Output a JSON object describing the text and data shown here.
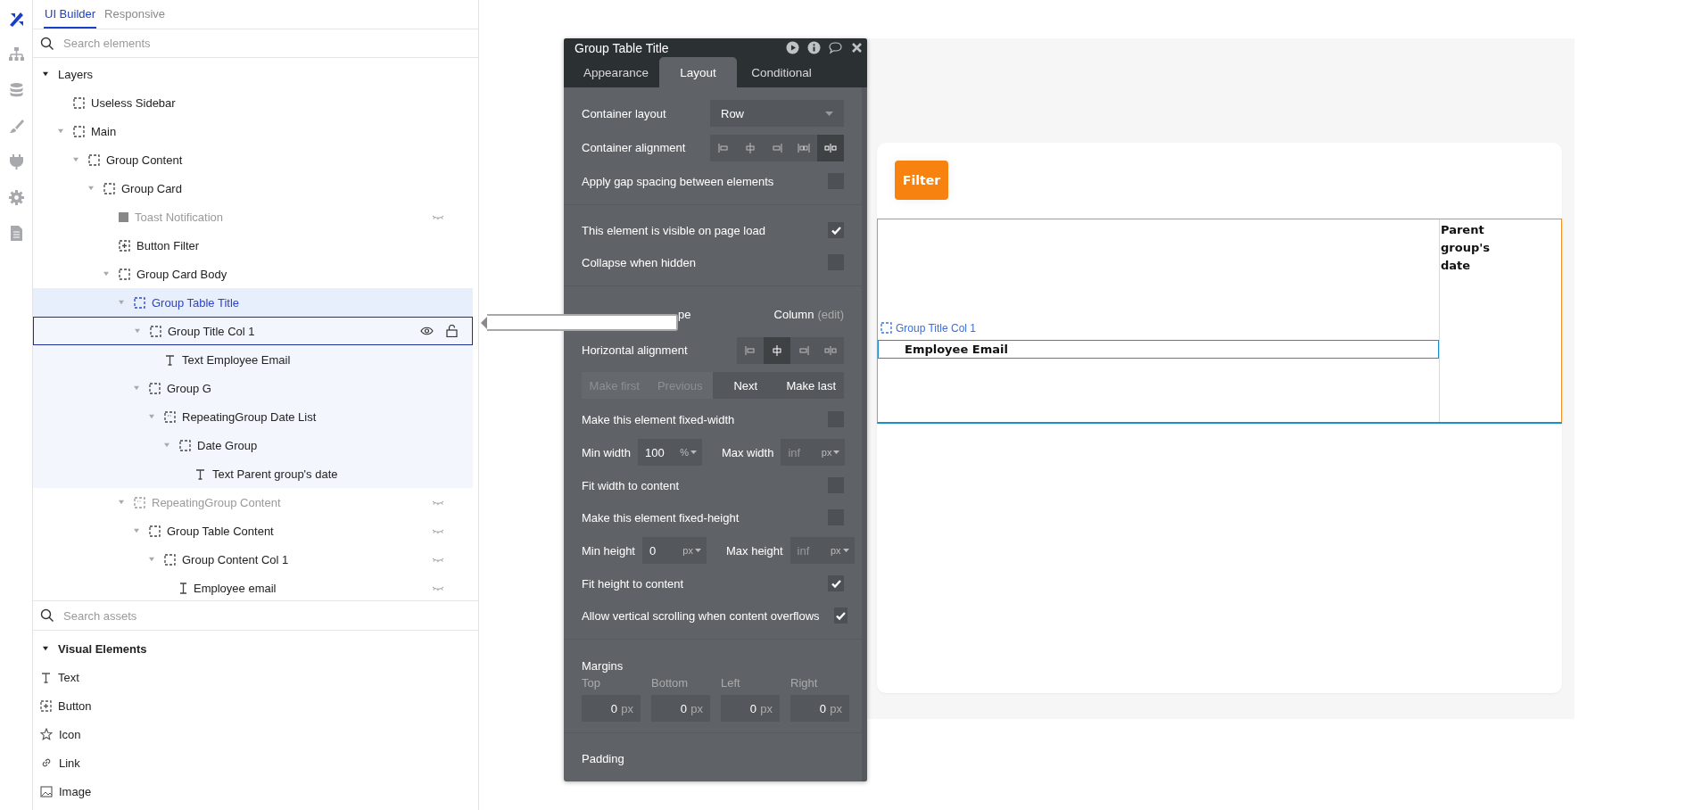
{
  "rail": {
    "items": [
      {
        "kind": "design",
        "selected": true
      },
      {
        "kind": "structure",
        "selected": false
      },
      {
        "kind": "data",
        "selected": false
      },
      {
        "kind": "styles",
        "selected": false
      },
      {
        "kind": "plugins",
        "selected": false
      },
      {
        "kind": "settings",
        "selected": false
      },
      {
        "kind": "logs",
        "selected": false
      }
    ]
  },
  "sidebar": {
    "tabs": [
      {
        "label": "UI Builder",
        "selected": true
      },
      {
        "label": "Responsive",
        "selected": false
      }
    ],
    "search": {
      "placeholder": "Search elements"
    },
    "layers": {
      "label": "Layers",
      "expanded": true,
      "items": [
        {
          "label": "Useless Sidebar",
          "kind": "group",
          "selected": false,
          "active": false,
          "hidden": false,
          "muted": false
        },
        {
          "label": "Main",
          "kind": "group",
          "expanded": true,
          "selected": false,
          "active": false,
          "hidden": false,
          "muted": false,
          "children": [
            {
              "label": "Group Content",
              "kind": "group",
              "expanded": true,
              "selected": false,
              "active": false,
              "hidden": false,
              "muted": false,
              "children": [
                {
                  "label": "Group Card",
                  "kind": "group",
                  "expanded": true,
                  "selected": false,
                  "active": false,
                  "hidden": false,
                  "muted": false,
                  "children": [
                    {
                      "label": "Toast Notification",
                      "kind": "shape",
                      "selected": false,
                      "active": false,
                      "hidden": true,
                      "muted": true
                    },
                    {
                      "label": "Button Filter",
                      "kind": "button",
                      "selected": false,
                      "active": false,
                      "hidden": false,
                      "muted": false
                    },
                    {
                      "label": "Group Card Body",
                      "kind": "group",
                      "expanded": true,
                      "selected": false,
                      "active": false,
                      "hidden": false,
                      "muted": false,
                      "children": [
                        {
                          "label": "Group Table Title",
                          "kind": "group",
                          "expanded": true,
                          "selected": false,
                          "active": true,
                          "hidden": false,
                          "muted": false,
                          "children": [
                            {
                              "label": "Group Title Col 1",
                              "kind": "group",
                              "expanded": true,
                              "selected": true,
                              "active": false,
                              "hidden": false,
                              "muted": false,
                              "children": [
                                {
                                  "label": "Text Employee Email",
                                  "kind": "text",
                                  "selected": false,
                                  "active": false,
                                  "hidden": false,
                                  "muted": false
                                }
                              ]
                            },
                            {
                              "label": "Group G",
                              "kind": "group",
                              "expanded": true,
                              "selected": false,
                              "active": false,
                              "hidden": false,
                              "muted": false,
                              "children": [
                                {
                                  "label": "RepeatingGroup Date List",
                                  "kind": "repeating",
                                  "expanded": true,
                                  "selected": false,
                                  "active": false,
                                  "hidden": false,
                                  "muted": false,
                                  "children": [
                                    {
                                      "label": "Date Group",
                                      "kind": "group",
                                      "expanded": true,
                                      "selected": false,
                                      "active": false,
                                      "hidden": false,
                                      "muted": false,
                                      "children": [
                                        {
                                          "label": "Text Parent group's date",
                                          "kind": "text",
                                          "selected": false,
                                          "active": false,
                                          "hidden": false,
                                          "muted": false
                                        }
                                      ]
                                    }
                                  ]
                                }
                              ]
                            }
                          ]
                        },
                        {
                          "label": "RepeatingGroup Content",
                          "kind": "repeating",
                          "expanded": true,
                          "selected": false,
                          "active": false,
                          "hidden": true,
                          "muted": true,
                          "children": [
                            {
                              "label": "Group Table Content",
                              "kind": "group",
                              "expanded": true,
                              "selected": false,
                              "active": false,
                              "hidden": true,
                              "muted": false,
                              "children": [
                                {
                                  "label": "Group Content Col 1",
                                  "kind": "group",
                                  "expanded": true,
                                  "selected": false,
                                  "active": false,
                                  "hidden": true,
                                  "muted": false,
                                  "children": [
                                    {
                                      "label": "Employee email",
                                      "kind": "input",
                                      "selected": false,
                                      "active": false,
                                      "hidden": true,
                                      "muted": false
                                    }
                                  ]
                                }
                              ]
                            }
                          ]
                        }
                      ]
                    }
                  ]
                }
              ]
            }
          ]
        }
      ]
    },
    "assets_search": {
      "placeholder": "Search assets"
    },
    "assets": {
      "label": "Visual Elements",
      "expanded": true,
      "items": [
        {
          "label": "Text",
          "kind": "text"
        },
        {
          "label": "Button",
          "kind": "button"
        },
        {
          "label": "Icon",
          "kind": "icon"
        },
        {
          "label": "Link",
          "kind": "link"
        },
        {
          "label": "Image",
          "kind": "image"
        }
      ]
    }
  },
  "property_editor": {
    "title": "Group Table Title",
    "tabs": [
      {
        "label": "Appearance",
        "selected": false
      },
      {
        "label": "Layout",
        "selected": true
      },
      {
        "label": "Conditional",
        "selected": false
      }
    ],
    "sections": [
      {
        "rows": [
          {
            "kind": "dropdown",
            "label": "Container layout",
            "value": "Row"
          },
          {
            "kind": "align",
            "label": "Container alignment",
            "options": [
              {
                "kind": "left",
                "selected": false
              },
              {
                "kind": "center",
                "selected": false
              },
              {
                "kind": "right",
                "selected": false
              },
              {
                "kind": "space",
                "selected": false
              },
              {
                "kind": "spread",
                "selected": true
              }
            ]
          },
          {
            "kind": "checkbox",
            "label": "Apply gap spacing between elements",
            "checked": false
          }
        ]
      },
      {
        "rows": [
          {
            "kind": "checkbox",
            "label": "This element is visible on page load",
            "checked": true
          },
          {
            "kind": "checkbox",
            "label": "Collapse when hidden",
            "checked": false
          }
        ]
      },
      {
        "rows": [
          {
            "kind": "type",
            "label": "pe",
            "value": "Column",
            "link": "(edit)"
          },
          {
            "kind": "align",
            "label": "Horizontal alignment",
            "options": [
              {
                "kind": "left",
                "selected": false
              },
              {
                "kind": "center",
                "selected": true
              },
              {
                "kind": "right",
                "selected": false
              },
              {
                "kind": "spread",
                "selected": false
              }
            ]
          },
          {
            "kind": "order",
            "buttons": [
              {
                "label": "Make first",
                "disabled": true
              },
              {
                "label": "Previous",
                "disabled": true
              },
              {
                "label": "Next",
                "disabled": false
              },
              {
                "label": "Make last",
                "disabled": false
              }
            ]
          },
          {
            "kind": "checkbox",
            "label": "Make this element fixed-width",
            "checked": false
          },
          {
            "kind": "dims",
            "fields": [
              {
                "label": "Min width",
                "value": "100",
                "unit": "%"
              },
              {
                "label": "Max width",
                "placeholder": "inf",
                "unit": "px"
              }
            ]
          },
          {
            "kind": "checkbox",
            "label": "Fit width to content",
            "checked": false
          },
          {
            "kind": "checkbox",
            "label": "Make this element fixed-height",
            "checked": false
          },
          {
            "kind": "dims",
            "fields": [
              {
                "label": "Min height",
                "value": "0",
                "unit": "px"
              },
              {
                "label": "Max height",
                "placeholder": "inf",
                "unit": "px"
              }
            ]
          },
          {
            "kind": "checkbox",
            "label": "Fit height to content",
            "checked": true
          },
          {
            "kind": "checkbox",
            "label": "Allow vertical scrolling when content overflows",
            "checked": true
          }
        ]
      },
      {
        "rows": [
          {
            "kind": "boxes",
            "label": "Margins",
            "fields": [
              {
                "label": "Top",
                "value": "0",
                "unit": "px"
              },
              {
                "label": "Bottom",
                "value": "0",
                "unit": "px"
              },
              {
                "label": "Left",
                "value": "0",
                "unit": "px"
              },
              {
                "label": "Right",
                "value": "0",
                "unit": "px"
              }
            ]
          }
        ]
      },
      {
        "rows": [
          {
            "kind": "heading",
            "label": "Padding"
          }
        ]
      }
    ]
  },
  "canvas": {
    "filter_button": {
      "label": "Filter"
    },
    "selection_tag": {
      "label": "Group Title Col 1"
    },
    "table_title": {
      "column_1": "Employee Email",
      "column_2": "Parent group's date"
    }
  }
}
